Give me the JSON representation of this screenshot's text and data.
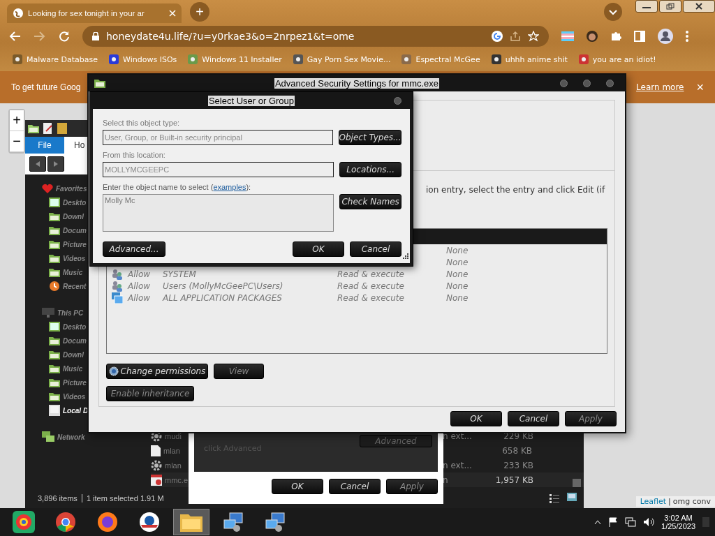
{
  "browser": {
    "tab": {
      "title": "Looking for sex tonight in your ar",
      "selected": true
    },
    "new_tab": "+",
    "url": "honeydate4u.life/?u=y0rkae3&o=2nrpez1&t=ome",
    "bookmarks": [
      "Malware Database",
      "Windows ISOs",
      "Windows 11 Installer",
      "Gay Porn Sex Movie...",
      "Espectral McGee",
      "uhhh anime shit",
      "you are an idiot!"
    ]
  },
  "infobar": {
    "text": "To get future Goog",
    "link": "Learn more",
    "close": "×"
  },
  "map": {
    "zoom_in": "+",
    "zoom_out": "−",
    "attribution_link": "Leaflet",
    "attribution_separator": "|",
    "attribution": "omg conv"
  },
  "explorer": {
    "ribbon_tabs": [
      {
        "label": "File",
        "selected": true
      },
      {
        "label": "Ho",
        "selected": false
      }
    ],
    "nav": [
      {
        "label": "Favorites",
        "kind": "heart",
        "children": [
          {
            "label": "Deskto",
            "kind": "desktop",
            "selected": false
          },
          {
            "label": "Downl",
            "kind": "folder",
            "selected": false
          },
          {
            "label": "Docum",
            "kind": "folder",
            "selected": false
          },
          {
            "label": "Picture",
            "kind": "folder",
            "selected": false
          },
          {
            "label": "Videos",
            "kind": "folder",
            "selected": false
          },
          {
            "label": "Music",
            "kind": "folder",
            "selected": false
          },
          {
            "label": "Recent",
            "kind": "recent",
            "selected": false
          }
        ]
      },
      {
        "label": "This PC",
        "kind": "pc",
        "children": [
          {
            "label": "Deskto",
            "kind": "desktop",
            "selected": false
          },
          {
            "label": "Docum",
            "kind": "folder",
            "selected": false
          },
          {
            "label": "Downl",
            "kind": "folder",
            "selected": false
          },
          {
            "label": "Music",
            "kind": "folder",
            "selected": false
          },
          {
            "label": "Picture",
            "kind": "folder",
            "selected": false
          },
          {
            "label": "Videos",
            "kind": "folder",
            "selected": false
          },
          {
            "label": "Local D",
            "kind": "drive",
            "selected": true
          }
        ]
      },
      {
        "label": "Network",
        "kind": "network"
      }
    ],
    "files": [
      {
        "name": "mudi",
        "kind": "gear",
        "type": "n ext...",
        "size": "229 KB",
        "selected": false
      },
      {
        "name": "mlan",
        "kind": "file",
        "size": "658 KB",
        "selected": false
      },
      {
        "name": "mlan",
        "kind": "gear",
        "type": "n ext...",
        "size": "233 KB",
        "selected": false
      },
      {
        "name": "mmc.e",
        "kind": "app",
        "type": "n",
        "size": "1,957 KB",
        "selected": true
      }
    ],
    "status_items": "3,896 items",
    "status_selected": "1 item selected  1.91 M"
  },
  "properties": {
    "text": "click Advanced",
    "advanced": "Advanced",
    "buttons": [
      "OK",
      "Cancel",
      "Apply"
    ]
  },
  "advanced": {
    "title": "Advanced Security Settings for mmc.exe",
    "hint": "ion entry, select the entry and click Edit (if",
    "rows": [
      {
        "inherited": "None"
      },
      {
        "inherited": "None"
      },
      {
        "kind": "group",
        "type": "Allow",
        "principal": "SYSTEM",
        "access": "Read & execute",
        "inherited": "None"
      },
      {
        "kind": "group",
        "type": "Allow",
        "principal": "Users (MollyMcGeePC\\Users)",
        "access": "Read & execute",
        "inherited": "None"
      },
      {
        "kind": "package",
        "type": "Allow",
        "principal": "ALL APPLICATION PACKAGES",
        "access": "Read & execute",
        "inherited": "None"
      }
    ],
    "change_permissions": "Change permissions",
    "view": "View",
    "enable_inheritance": "Enable inheritance",
    "buttons": [
      {
        "label": "OK",
        "disabled": false
      },
      {
        "label": "Cancel",
        "disabled": false
      },
      {
        "label": "Apply",
        "disabled": true
      }
    ]
  },
  "dialog": {
    "title": "Select User or Group",
    "type_label": "Select this object type:",
    "type_value": "User, Group, or Built-in security principal",
    "object_types": "Object Types...",
    "location_label": "From this location:",
    "location_value": "MOLLYMCGEEPC",
    "locations": "Locations...",
    "name_label_before": "Enter the object name to select (",
    "name_link": "examples",
    "name_label_after": "):",
    "name_value": "Molly Mc",
    "check_names": "Check Names",
    "advanced": "Advanced...",
    "ok": "OK",
    "cancel": "Cancel"
  },
  "taskbar": {
    "apps": [
      {
        "kind": "start",
        "selected": false
      },
      {
        "kind": "chrome",
        "selected": false
      },
      {
        "kind": "firefox",
        "selected": false
      },
      {
        "kind": "circle",
        "selected": false
      },
      {
        "kind": "folder",
        "selected": true
      },
      {
        "kind": "network",
        "selected": false
      },
      {
        "kind": "network",
        "selected": false
      }
    ],
    "time": "3:02 AM",
    "date": "1/25/2023"
  }
}
